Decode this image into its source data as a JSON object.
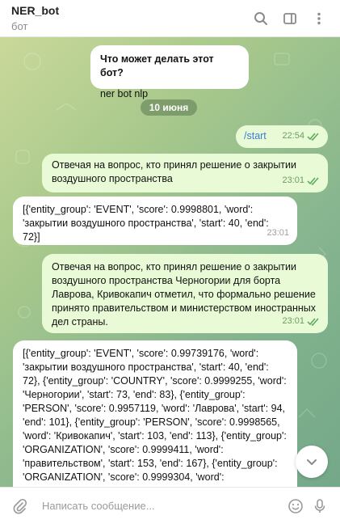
{
  "header": {
    "title": "NER_bot",
    "subtitle": "бот"
  },
  "intro": {
    "question": "Что может делать этот бот?",
    "answer": "ner bot nlp"
  },
  "date_separator": "10 июня",
  "messages": [
    {
      "direction": "out",
      "text": "/start",
      "time": "22:54"
    },
    {
      "direction": "out",
      "text": "Отвечая на вопрос, кто принял решение о закрытии воздушного пространства",
      "time": "23:01"
    },
    {
      "direction": "in",
      "text": "[{'entity_group': 'EVENT', 'score': 0.9998801, 'word': 'закрытии воздушного пространства', 'start': 40, 'end': 72}]",
      "time": "23:01"
    },
    {
      "direction": "out",
      "text": "Отвечая на вопрос, кто принял решение о закрытии воздушного пространства Черногории для борта Лаврова, Кривокапич отметил, что формально решение принято правительством и министерством иностранных дел страны.",
      "time": "23:01"
    },
    {
      "direction": "in",
      "text": "[{'entity_group': 'EVENT', 'score': 0.99739176, 'word': 'закрытии воздушного пространства', 'start': 40, 'end': 72}, {'entity_group': 'COUNTRY', 'score': 0.9999255, 'word': 'Черногории', 'start': 73, 'end': 83}, {'entity_group': 'PERSON', 'score': 0.9957119, 'word': 'Лаврова', 'start': 94, 'end': 101}, {'entity_group': 'PERSON', 'score': 0.9998565, 'word': 'Кривокапич', 'start': 103, 'end': 113}, {'entity_group': 'ORGANIZATION', 'score': 0.9999411, 'word': 'правительством', 'start': 153, 'end': 167}, {'entity_group': 'ORGANIZATION', 'score': 0.9999304, 'word':",
      "time": ""
    }
  ],
  "composer": {
    "placeholder": "Написать сообщение..."
  },
  "icons": {
    "search": "search-icon",
    "sidebar": "sidebar-toggle-icon",
    "menu": "more-vertical-icon",
    "attach": "paperclip-icon",
    "emoji": "emoji-icon",
    "mic": "microphone-icon",
    "scroll": "chevron-down-icon",
    "read": "double-check-icon"
  },
  "colors": {
    "outgoing_bubble": "#e9fbd6",
    "incoming_bubble": "#ffffff",
    "check": "#5aa85a"
  }
}
